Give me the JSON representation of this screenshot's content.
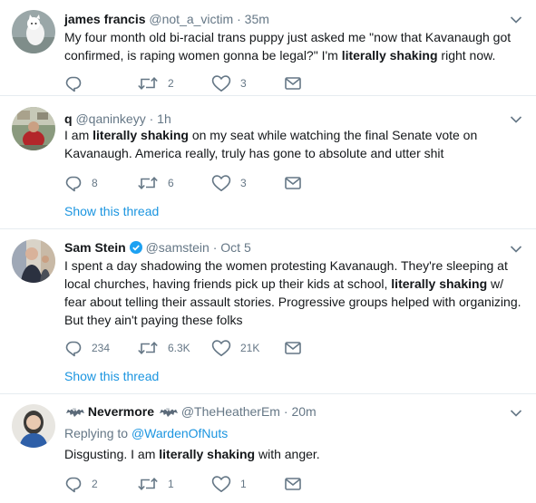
{
  "tweets": [
    {
      "name": "james francis",
      "handle": "@not_a_victim",
      "dot": "·",
      "time": "35m",
      "text": [
        "My four month old bi-racial trans puppy just asked me \"now that Kavanaugh got confirmed, is raping women gonna be legal?\" I'm ",
        "literally shaking",
        " right now."
      ],
      "replies": "",
      "retweets": "2",
      "likes": "3"
    },
    {
      "name": "q",
      "handle": "@qaninkeyy",
      "dot": "·",
      "time": "1h",
      "text": [
        "I am ",
        "literally shaking",
        " on my seat while watching the final Senate vote on Kavanaugh. America really, truly has gone to absolute and utter shit"
      ],
      "replies": "8",
      "retweets": "6",
      "likes": "3",
      "show_thread": "Show this thread"
    },
    {
      "name": "Sam Stein",
      "handle": "@samstein",
      "dot": "·",
      "time": "Oct 5",
      "verified": true,
      "text": [
        "I spent a day shadowing the women protesting Kavanaugh. They're sleeping at local churches, having friends pick up their kids at school, ",
        "literally shaking",
        " w/ fear about telling their assault stories. Progressive groups helped with organizing. But they ain't paying these folks"
      ],
      "replies": "234",
      "retweets": "6.3K",
      "likes": "21K",
      "show_thread": "Show this thread"
    },
    {
      "name": "Nevermore",
      "handle": "@TheHeatherEm",
      "dot": "·",
      "time": "20m",
      "replying_prefix": "Replying to ",
      "replying_to": "@WardenOfNuts",
      "text": [
        "Disgusting. I am ",
        "literally shaking",
        " with anger."
      ],
      "replies": "2",
      "retweets": "1",
      "likes": "1"
    }
  ],
  "icons": [
    "reply-icon",
    "retweet-icon",
    "like-icon",
    "message-icon",
    "chevron-down-icon",
    "verified-badge-icon",
    "bat-emoji-icon"
  ],
  "colors": {
    "link": "#1b95e0",
    "muted": "#657786",
    "text": "#14171a",
    "divider": "#e6ecf0"
  }
}
